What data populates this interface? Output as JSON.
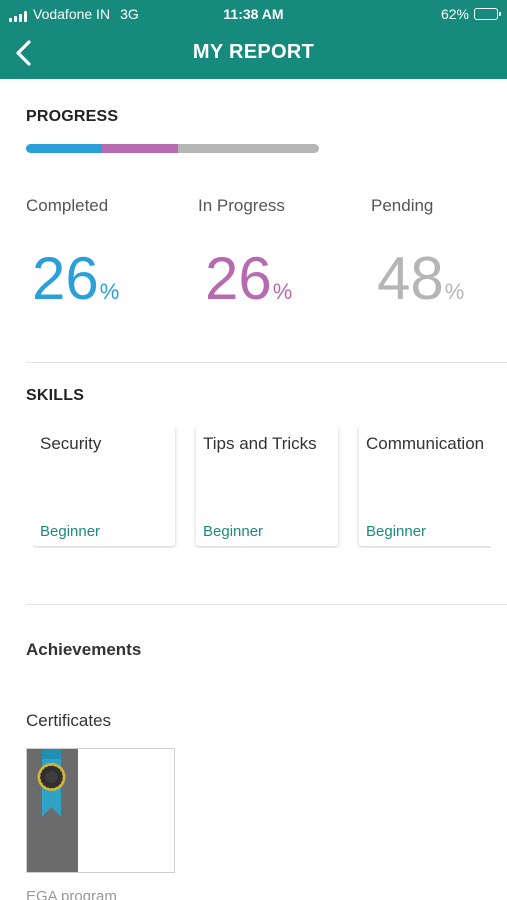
{
  "status_bar": {
    "carrier": "Vodafone IN",
    "network": "3G",
    "time": "11:38 AM",
    "battery_text": "62%",
    "battery_level": 0.62
  },
  "nav": {
    "back_icon": "chevron-left-icon",
    "title": "MY REPORT"
  },
  "progress": {
    "heading": "PROGRESS",
    "bar_fractions": {
      "completed": 0.26,
      "in_progress": 0.26,
      "pending": 0.48
    },
    "stats": [
      {
        "label": "Completed",
        "value": "26",
        "unit": "%",
        "color": "#2a9fd8"
      },
      {
        "label": "In Progress",
        "value": "26",
        "unit": "%",
        "color": "#b86ab0"
      },
      {
        "label": "Pending",
        "value": "48",
        "unit": "%",
        "color": "#b5b5b5"
      }
    ]
  },
  "skills": {
    "heading": "SKILLS",
    "items": [
      {
        "name": "Security",
        "level": "Beginner"
      },
      {
        "name": "Tips and Tricks",
        "level": "Beginner"
      },
      {
        "name": "Communication",
        "level": "Beginner"
      }
    ]
  },
  "achievements": {
    "heading": "Achievements",
    "certificates_heading": "Certificates",
    "certificate": {
      "name": "EGA program",
      "icon": "award-ribbon-icon"
    }
  },
  "colors": {
    "header": "#178a7e",
    "completed": "#2a9fd8",
    "in_progress": "#b86ab0",
    "pending": "#b5b5b5",
    "level_text": "#1b8a7d"
  }
}
